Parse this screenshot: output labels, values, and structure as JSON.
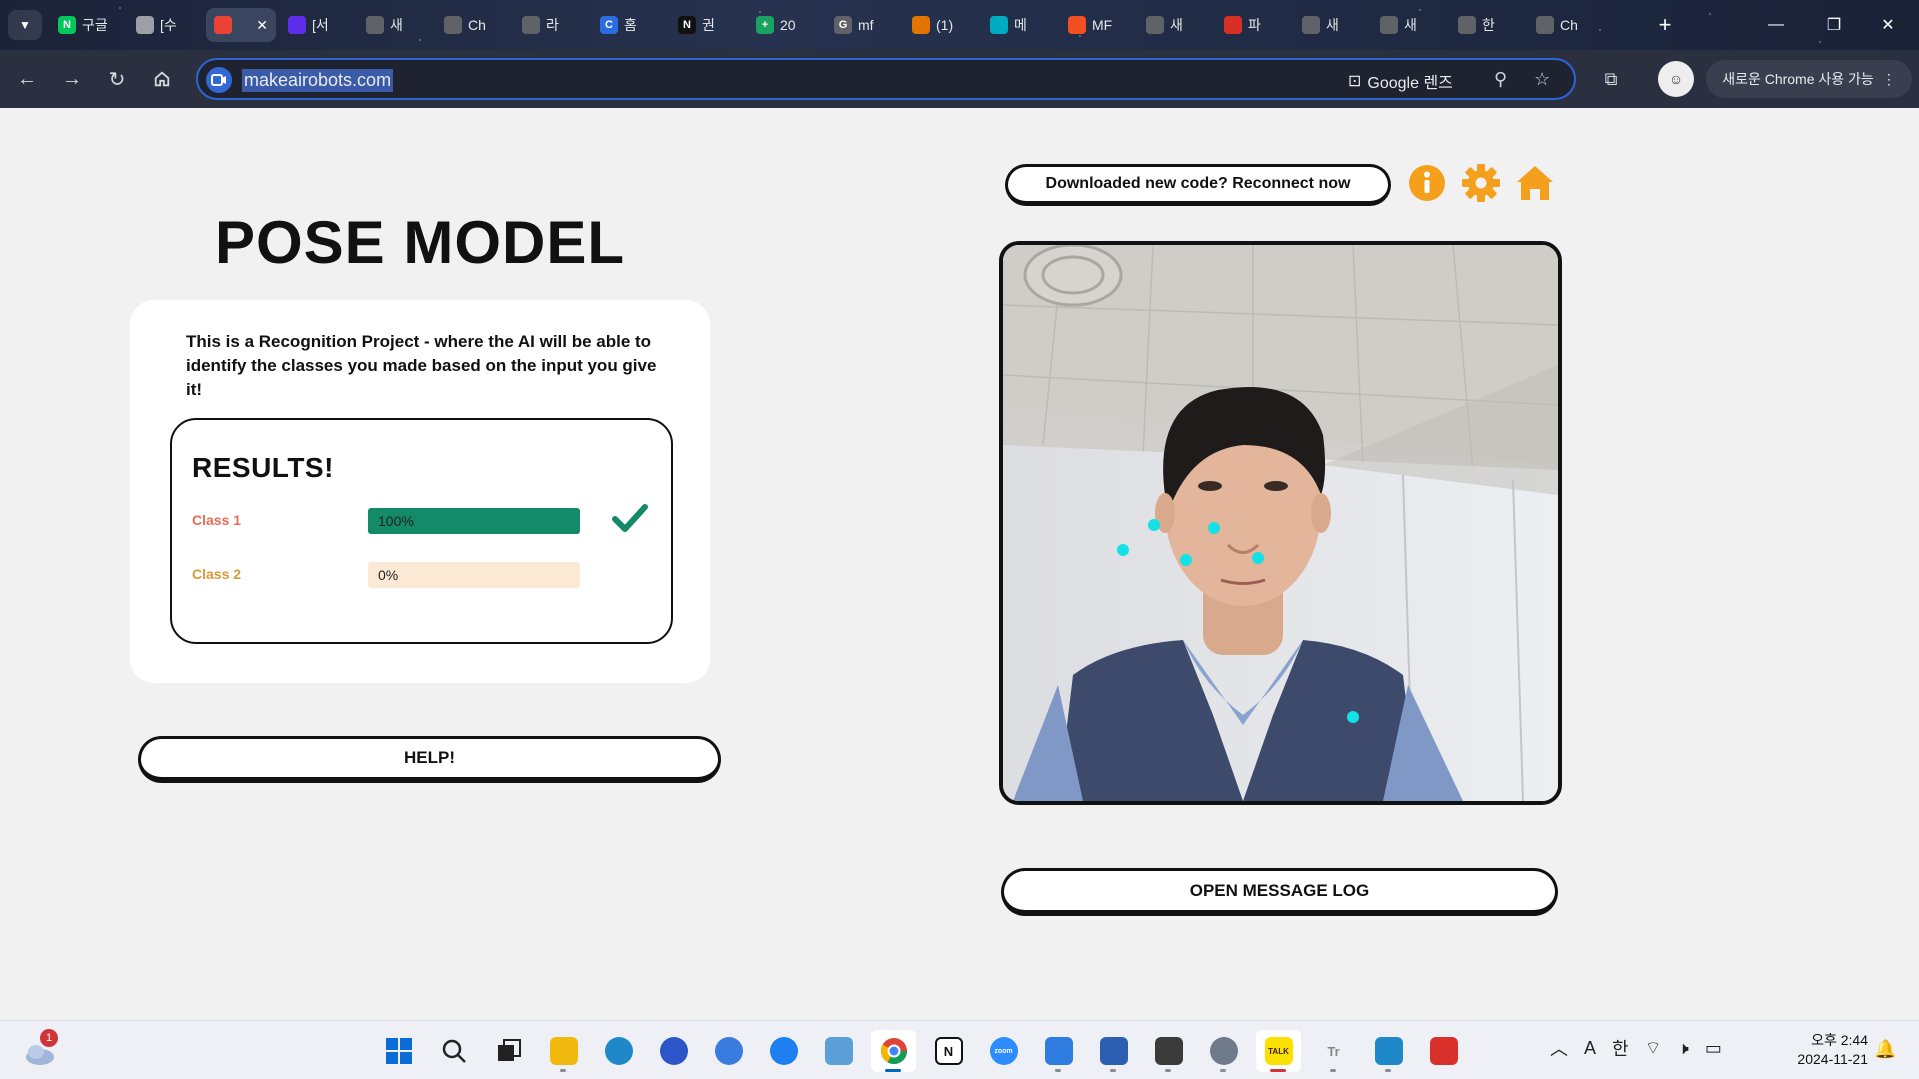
{
  "browser": {
    "tabs": [
      {
        "label": "구글",
        "favicon": "N",
        "color": "#03c75a"
      },
      {
        "label": "[수",
        "favicon": "",
        "color": "#9aa0a6"
      },
      {
        "label": "",
        "favicon": "",
        "color": "#ea4335",
        "active": true
      },
      {
        "label": "[서",
        "favicon": "",
        "color": "#5f2eea"
      },
      {
        "label": "새",
        "favicon": "",
        "color": "#5f6368"
      },
      {
        "label": "Ch",
        "favicon": "",
        "color": "#5f6368"
      },
      {
        "label": "라",
        "favicon": "",
        "color": "#5f6368"
      },
      {
        "label": "홈",
        "favicon": "C",
        "color": "#2d6cdf"
      },
      {
        "label": "권",
        "favicon": "N",
        "color": "#111111"
      },
      {
        "label": "20",
        "favicon": "+",
        "color": "#1aa260"
      },
      {
        "label": "mf",
        "favicon": "G",
        "color": "#5f6368"
      },
      {
        "label": "(1)",
        "favicon": "",
        "color": "#e37400"
      },
      {
        "label": "메",
        "favicon": "",
        "color": "#00acc1"
      },
      {
        "label": "MF",
        "favicon": "",
        "color": "#f25022"
      },
      {
        "label": "새",
        "favicon": "",
        "color": "#5f6368"
      },
      {
        "label": "파",
        "favicon": "",
        "color": "#d93025"
      },
      {
        "label": "새",
        "favicon": "",
        "color": "#5f6368"
      },
      {
        "label": "새",
        "favicon": "",
        "color": "#5f6368"
      },
      {
        "label": "한",
        "favicon": "",
        "color": "#5f6368"
      },
      {
        "label": "Ch",
        "favicon": "",
        "color": "#5f6368"
      }
    ],
    "url": "makeairobots.com",
    "lens_label": "Google 렌즈",
    "update_label": "새로운 Chrome 사용 가능"
  },
  "page": {
    "title": "POSE MODEL",
    "description": "This is a Recognition Project - where the AI will be able to identify the classes you made based on the input you give it!",
    "results_title": "RESULTS!",
    "classes": [
      {
        "name": "Class 1",
        "percent_label": "100%",
        "fraction": 1.0,
        "label_color": "#e46d5a",
        "fill_color": "#138a68",
        "track_color": "#dbe9e4"
      },
      {
        "name": "Class 2",
        "percent_label": "0%",
        "fraction": 0.0,
        "label_color": "#d79a3a",
        "fill_color": "#e9a74a",
        "track_color": "#fbe9d5"
      }
    ],
    "help_label": "HELP!",
    "reconnect_label": "Downloaded new code? Reconnect now",
    "message_log_label": "OPEN MESSAGE LOG",
    "accent_color": "#f4a01c",
    "keypoint_color": "#14e1e6"
  },
  "taskbar": {
    "weather_badge": "1",
    "clock_time": "오후 2:44",
    "clock_date": "2024-11-21",
    "ime_label": "한",
    "font_label": "A"
  }
}
